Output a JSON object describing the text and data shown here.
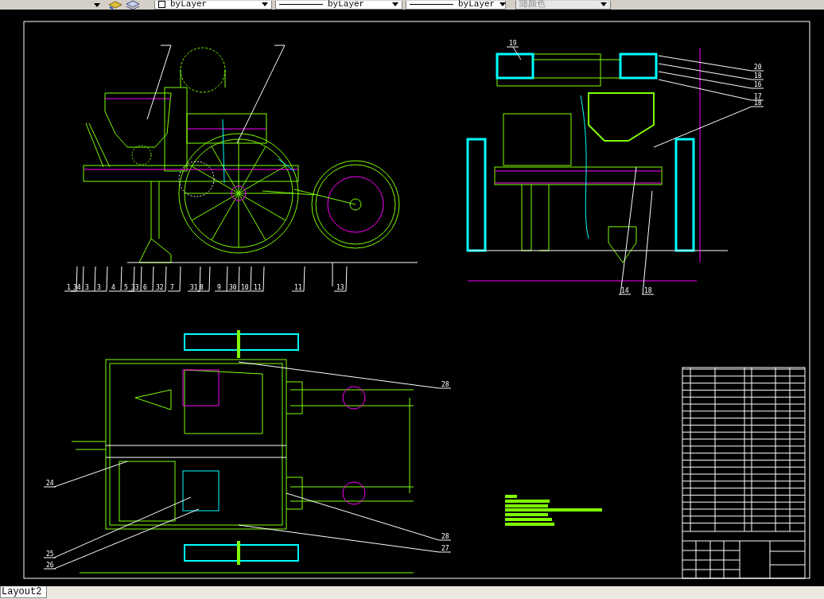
{
  "toolbar": {
    "layer_controls": [
      {
        "kind": "layer",
        "value": "byLayer"
      },
      {
        "kind": "linetype",
        "value": "byLayer"
      },
      {
        "kind": "lineweight",
        "value": "byLayer"
      }
    ],
    "color_control": {
      "value": "随颜色",
      "disabled": true
    }
  },
  "drawing": {
    "side_view": {
      "callouts": [
        "1",
        "34",
        "3",
        "3",
        "4",
        "5",
        "33",
        "6",
        "32",
        "7",
        "31",
        "8",
        "9",
        "30",
        "10",
        "11",
        "11",
        "13"
      ]
    },
    "end_view": {
      "callouts": [
        "19",
        "20",
        "18",
        "16",
        "17",
        "18",
        "14",
        "18"
      ]
    },
    "top_view": {
      "callouts": [
        "28",
        "24",
        "25",
        "26",
        "28",
        "27"
      ]
    }
  },
  "layout_tabs": [
    {
      "label": "Layout2",
      "selected": true
    }
  ]
}
